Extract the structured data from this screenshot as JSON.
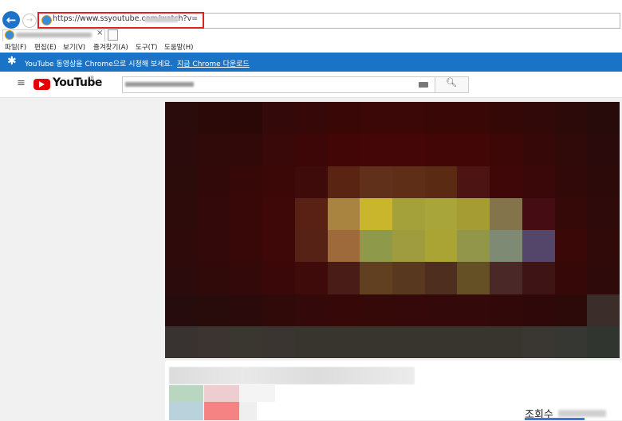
{
  "browser": {
    "address_url": "https://www.ssyoutube.com/watch?v=",
    "menu": [
      "파일(F)",
      "편집(E)",
      "보기(V)",
      "즐겨찾기(A)",
      "도구(T)",
      "도움말(H)"
    ],
    "tab_close": "×"
  },
  "promo": {
    "text": "YouTube 동영상을 Chrome으로 시청해 보세요.",
    "link": "지금 Chrome 다운로드"
  },
  "youtube": {
    "logo_text": "YouTube",
    "region": "KR"
  },
  "video_panel": {
    "views_label": "조회수"
  },
  "icons": {
    "back": "back-arrow-icon",
    "forward": "forward-arrow-icon",
    "menu": "hamburger-icon",
    "search": "search-icon",
    "keyboard": "keyboard-icon",
    "star": "star-icon"
  },
  "colors": {
    "promo_bar": "#1a73c7",
    "youtube_red": "#e60000",
    "address_highlight": "#dd2222"
  }
}
